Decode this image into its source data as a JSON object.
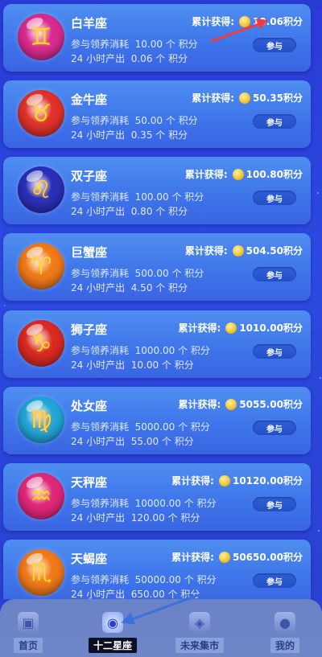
{
  "labels": {
    "accumulated_prefix": "累计获得:",
    "accumulated_suffix": "积分",
    "cost_prefix": "参与领养消耗",
    "output_prefix": "24 小时产出",
    "points_unit": "个 积分",
    "join_button": "参与"
  },
  "zodiacs": [
    {
      "name": "白羊座",
      "earned": "10.06",
      "cost": "10.00",
      "output": "0.06",
      "icon": "gemini-icon",
      "glyph": "♊",
      "color": "#d92b8f"
    },
    {
      "name": "金牛座",
      "earned": "50.35",
      "cost": "50.00",
      "output": "0.35",
      "icon": "taurus-icon",
      "glyph": "♉",
      "color": "#e0322a"
    },
    {
      "name": "双子座",
      "earned": "100.80",
      "cost": "100.00",
      "output": "0.80",
      "icon": "leo-icon",
      "glyph": "♌",
      "color": "#2a2fb8"
    },
    {
      "name": "巨蟹座",
      "earned": "504.50",
      "cost": "500.00",
      "output": "4.50",
      "icon": "aries-icon",
      "glyph": "♈",
      "color": "#f07a1a"
    },
    {
      "name": "狮子座",
      "earned": "1010.00",
      "cost": "1000.00",
      "output": "10.00",
      "icon": "capricorn-icon",
      "glyph": "♑",
      "color": "#d92a22"
    },
    {
      "name": "处女座",
      "earned": "5055.00",
      "cost": "5000.00",
      "output": "55.00",
      "icon": "virgo-icon",
      "glyph": "♍",
      "color": "#22a6d8"
    },
    {
      "name": "天秤座",
      "earned": "10120.00",
      "cost": "10000.00",
      "output": "120.00",
      "icon": "aquarius-icon",
      "glyph": "♒",
      "color": "#e0287a"
    },
    {
      "name": "天蝎座",
      "earned": "50650.00",
      "cost": "50000.00",
      "output": "650.00",
      "icon": "scorpio-icon",
      "glyph": "♏",
      "color": "#f07a1a"
    }
  ],
  "tabbar": {
    "items": [
      {
        "label": "首页",
        "icon": "home-icon",
        "glyph": "▣"
      },
      {
        "label": "十二星座",
        "icon": "crystal-ball-icon",
        "glyph": "◉"
      },
      {
        "label": "未来集市",
        "icon": "market-icon",
        "glyph": "◈"
      },
      {
        "label": "我的",
        "icon": "user-icon",
        "glyph": "●"
      }
    ],
    "active_index": 1
  }
}
